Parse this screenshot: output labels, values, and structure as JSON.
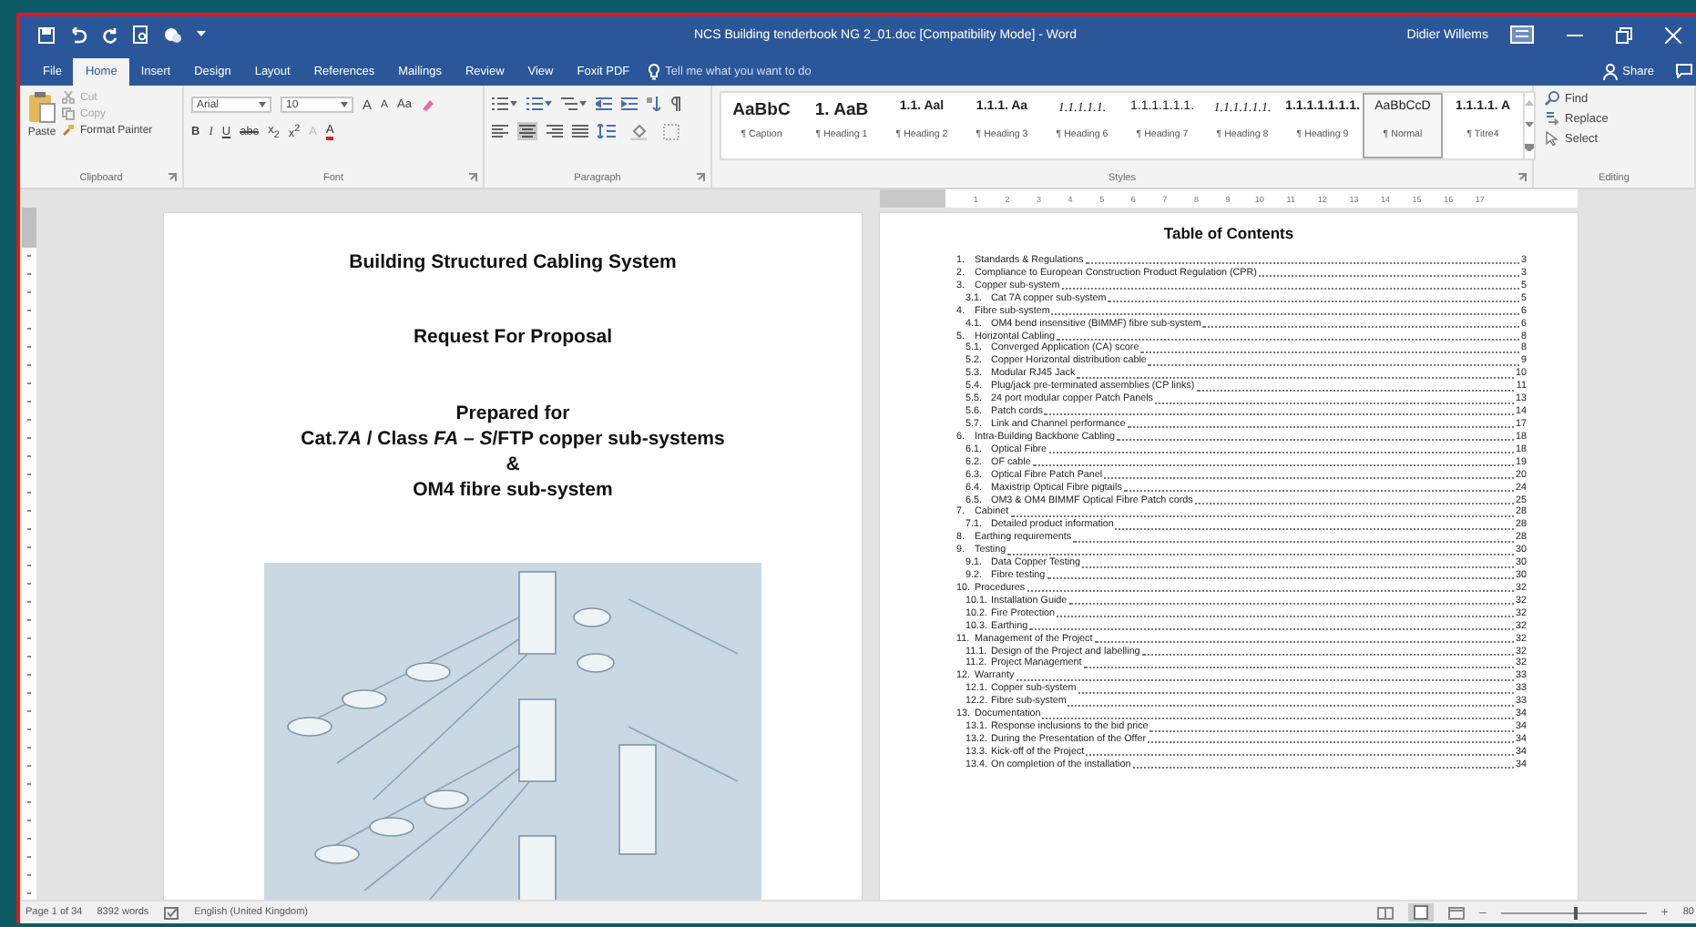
{
  "window": {
    "title": "NCS Building tenderbook NG 2_01.doc [Compatibility Mode]  -  Word",
    "user": "Didier Willems"
  },
  "tabs": [
    {
      "label": "File",
      "selected": false
    },
    {
      "label": "Home",
      "selected": true
    },
    {
      "label": "Insert",
      "selected": false
    },
    {
      "label": "Design",
      "selected": false
    },
    {
      "label": "Layout",
      "selected": false
    },
    {
      "label": "References",
      "selected": false
    },
    {
      "label": "Mailings",
      "selected": false
    },
    {
      "label": "Review",
      "selected": false
    },
    {
      "label": "View",
      "selected": false
    },
    {
      "label": "Foxit PDF",
      "selected": false
    }
  ],
  "tell_me": {
    "placeholder": "Tell me what you want to do"
  },
  "share": "Share",
  "clipboard": {
    "label": "Clipboard",
    "paste": "Paste",
    "items": [
      {
        "label": "Cut",
        "kind": "cut",
        "disabled": true
      },
      {
        "label": "Copy",
        "kind": "copy",
        "disabled": true
      },
      {
        "label": "Format Painter",
        "kind": "painter",
        "disabled": false
      }
    ]
  },
  "font": {
    "label": "Font",
    "name": "Arial",
    "size": "10",
    "top_buttons": [
      {
        "label": "A",
        "kind": "grow"
      },
      {
        "label": "A",
        "kind": "shrink"
      },
      {
        "label": "Aa",
        "kind": "case"
      }
    ],
    "bottom_buttons": [
      {
        "label": "B",
        "kind": "bold"
      },
      {
        "label": "I",
        "kind": "italic"
      },
      {
        "label": "U",
        "kind": "underline"
      },
      {
        "label": "abc",
        "kind": "strike"
      },
      {
        "label": "x$_{2}$",
        "kind": "sub"
      },
      {
        "label": "x$^{2}$",
        "kind": "sup"
      },
      {
        "label": "A",
        "kind": "effects"
      },
      {
        "label": "A",
        "kind": "color"
      }
    ]
  },
  "paragraph": {
    "label": "Paragraph"
  },
  "styles": {
    "label": "Styles",
    "items": [
      {
        "preview": "AaBbC",
        "label": "¶ Caption",
        "kind": "title",
        "selected": false
      },
      {
        "preview": "1. AaB",
        "label": "¶ Heading 1",
        "kind": "title",
        "selected": false
      },
      {
        "preview": "1.1. Aal",
        "label": "¶ Heading 2",
        "kind": "bold",
        "selected": false
      },
      {
        "preview": "1.1.1. Aa",
        "label": "¶ Heading 3",
        "kind": "bold",
        "selected": false
      },
      {
        "preview": "1.1.1.1.1.",
        "label": "¶ Heading 6",
        "kind": "italic",
        "selected": false
      },
      {
        "preview": "1.1.1.1.1.1.",
        "label": "¶ Heading 7",
        "kind": "plain",
        "selected": false
      },
      {
        "preview": "1.1.1.1.1.1.",
        "label": "¶ Heading 8",
        "kind": "italic",
        "selected": false
      },
      {
        "preview": "1.1.1.1.1.1.1.",
        "label": "¶ Heading 9",
        "kind": "bold",
        "selected": false
      },
      {
        "preview": "AaBbCcD",
        "label": "¶ Normal",
        "kind": "plain",
        "selected": true
      },
      {
        "preview": "1.1.1.1. A",
        "label": "¶ Titre4",
        "kind": "bold",
        "selected": false
      }
    ]
  },
  "editing": {
    "label": "Editing",
    "items": [
      {
        "label": "Find",
        "kind": "find"
      },
      {
        "label": "Replace",
        "kind": "replace"
      },
      {
        "label": "Select",
        "kind": "select"
      }
    ]
  },
  "ruler": [
    "1",
    "2",
    "3",
    "4",
    "5",
    "6",
    "7",
    "8",
    "9",
    "10",
    "11",
    "12",
    "13",
    "14",
    "15",
    "16",
    "17"
  ],
  "cover_page": {
    "lines": [
      "Building Structured Cabling System",
      "Request For Proposal",
      "Prepared for",
      "Cat.*7A* / Class *FA* – *S*/FTP copper sub-systems",
      "&",
      "OM4 fibre sub-system"
    ]
  },
  "toc": {
    "title": "Table of Contents",
    "entries": [
      {
        "number": "1.",
        "title": "Standards & Regulations",
        "page": "3"
      },
      {
        "number": "2.",
        "title": "Compliance to European Construction Product Regulation (CPR)",
        "page": "3"
      },
      {
        "number": "3.",
        "title": "Copper sub-system",
        "page": "5",
        "children": [
          {
            "number": "3.1.",
            "title": "Cat 7A copper sub-system",
            "page": "5"
          }
        ]
      },
      {
        "number": "4.",
        "title": "Fibre sub-system",
        "page": "6",
        "children": [
          {
            "number": "4.1.",
            "title": "OM4 bend insensitive (BIMMF) fibre sub-system",
            "page": "6"
          }
        ]
      },
      {
        "number": "5.",
        "title": "Horizontal Cabling",
        "page": "8",
        "children": [
          {
            "number": "5.1.",
            "title": "Converged Application (CA) score",
            "page": "8"
          },
          {
            "number": "5.2.",
            "title": "Copper Horizontal distribution cable",
            "page": "9"
          },
          {
            "number": "5.3.",
            "title": "Modular RJ45 Jack",
            "page": "10"
          },
          {
            "number": "5.4.",
            "title": "Plug/jack pre-terminated assemblies (CP links)",
            "page": "11"
          },
          {
            "number": "5.5.",
            "title": "24 port modular copper Patch Panels",
            "page": "13"
          },
          {
            "number": "5.6.",
            "title": "Patch cords",
            "page": "14"
          },
          {
            "number": "5.7.",
            "title": "Link and Channel performance",
            "page": "17"
          }
        ]
      },
      {
        "number": "6.",
        "title": "Intra-Building Backbone Cabling",
        "page": "18",
        "children": [
          {
            "number": "6.1.",
            "title": "Optical Fibre",
            "page": "18"
          },
          {
            "number": "6.2.",
            "title": "OF cable",
            "page": "19"
          },
          {
            "number": "6.3.",
            "title": "Optical Fibre Patch Panel",
            "page": "20"
          },
          {
            "number": "6.4.",
            "title": "Maxistrip Optical Fibre pigtails",
            "page": "24"
          },
          {
            "number": "6.5.",
            "title": "OM3 & OM4 BIMMF Optical Fibre Patch cords",
            "page": "25"
          }
        ]
      },
      {
        "number": "7.",
        "title": "Cabinet",
        "page": "28",
        "children": [
          {
            "number": "7.1.",
            "title": "Detailed product information",
            "page": "28"
          }
        ]
      },
      {
        "number": "8.",
        "title": "Earthing requirements",
        "page": "28"
      },
      {
        "number": "9.",
        "title": "Testing",
        "page": "30",
        "children": [
          {
            "number": "9.1.",
            "title": "Data Copper Testing",
            "page": "30"
          },
          {
            "number": "9.2.",
            "title": "Fibre testing",
            "page": "30"
          }
        ]
      },
      {
        "number": "10.",
        "title": "Procedures",
        "page": "32",
        "children": [
          {
            "number": "10.1.",
            "title": "Installation Guide",
            "page": "32"
          },
          {
            "number": "10.2.",
            "title": "Fire Protection",
            "page": "32"
          },
          {
            "number": "10.3.",
            "title": "Earthing",
            "page": "32"
          }
        ]
      },
      {
        "number": "11.",
        "title": "Management of the Project",
        "page": "32",
        "children": [
          {
            "number": "11.1.",
            "title": "Design of the Project and labelling",
            "page": "32"
          },
          {
            "number": "11.2.",
            "title": "Project Management",
            "page": "32"
          }
        ]
      },
      {
        "number": "12.",
        "title": "Warranty",
        "page": "33",
        "children": [
          {
            "number": "12.1.",
            "title": "Copper sub-system",
            "page": "33"
          },
          {
            "number": "12.2.",
            "title": "Fibre sub-system",
            "page": "33"
          }
        ]
      },
      {
        "number": "13.",
        "title": "Documentation",
        "page": "34",
        "children": [
          {
            "number": "13.1.",
            "title": "Response inclusions to the bid price",
            "page": "34"
          },
          {
            "number": "13.2.",
            "title": "During the Presentation of the Offer",
            "page": "34"
          },
          {
            "number": "13.3.",
            "title": "Kick-off of the Project",
            "page": "34"
          },
          {
            "number": "13.4.",
            "title": "On completion of the installation",
            "page": "34"
          }
        ]
      }
    ]
  },
  "status_bar": {
    "page": "Page 1 of 34",
    "words": "8392 words",
    "language": "English (United Kingdom)",
    "zoom": {
      "level": 0.5
    },
    "zoom_out": "–",
    "zoom_in": "+",
    "zoom_text": "80"
  }
}
